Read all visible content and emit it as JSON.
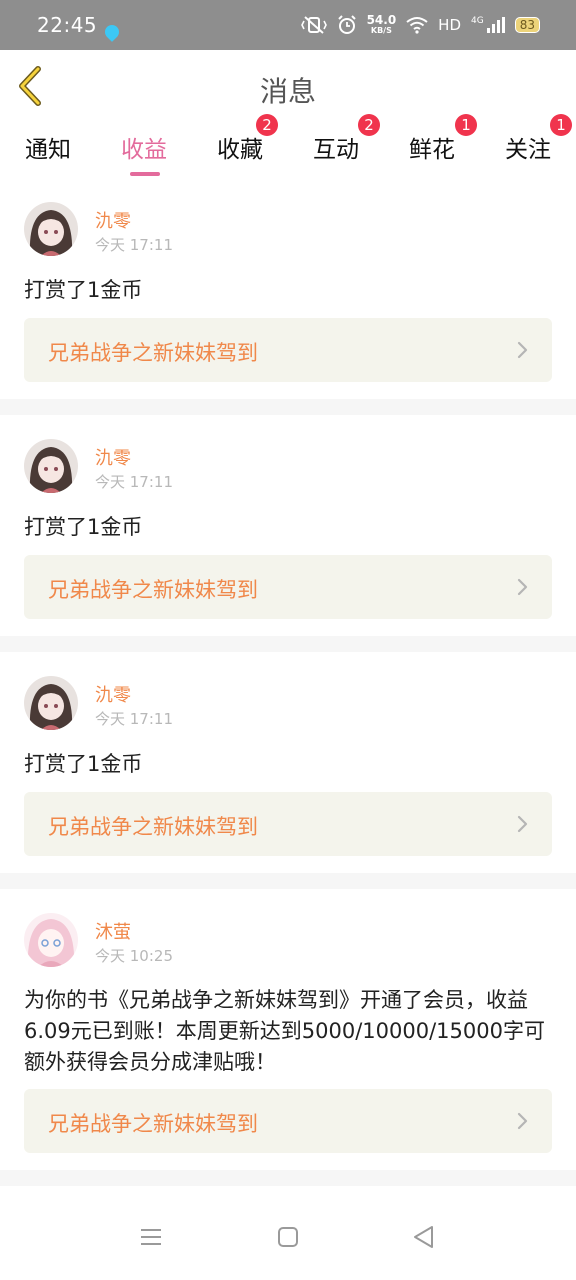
{
  "status_bar": {
    "time": "22:45",
    "net_speed_value": "54.0",
    "net_speed_unit": "KB/S",
    "hd": "HD",
    "network": "4G",
    "battery": "83"
  },
  "header": {
    "title": "消息",
    "back_icon": "chevron-left-icon"
  },
  "tabs": [
    {
      "label": "通知",
      "badge": "",
      "active": false
    },
    {
      "label": "收益",
      "badge": "",
      "active": true
    },
    {
      "label": "收藏",
      "badge": "2",
      "active": false
    },
    {
      "label": "互动",
      "badge": "2",
      "active": false
    },
    {
      "label": "鲜花",
      "badge": "1",
      "active": false
    },
    {
      "label": "关注",
      "badge": "1",
      "active": false
    }
  ],
  "messages": [
    {
      "user": "氿零",
      "time": "今天 17:11",
      "text": "打赏了1金币",
      "book": "兄弟战争之新妹妹驾到",
      "avatar": "avatar-dark-hair"
    },
    {
      "user": "氿零",
      "time": "今天 17:11",
      "text": "打赏了1金币",
      "book": "兄弟战争之新妹妹驾到",
      "avatar": "avatar-dark-hair"
    },
    {
      "user": "氿零",
      "time": "今天 17:11",
      "text": "打赏了1金币",
      "book": "兄弟战争之新妹妹驾到",
      "avatar": "avatar-dark-hair"
    },
    {
      "user": "沐萤",
      "time": "今天 10:25",
      "text": "为你的书《兄弟战争之新妹妹驾到》开通了会员，收益6.09元已到账！本周更新达到5000/10000/15000字可额外获得会员分成津贴哦！",
      "book": "兄弟战争之新妹妹驾到",
      "avatar": "avatar-pink-hair"
    }
  ],
  "colors": {
    "accent": "#e36b9c",
    "username": "#f0884a",
    "badge": "#f0344d",
    "book_bg": "#f4f4ec"
  },
  "nav": {
    "menu_icon": "menu-icon",
    "home_icon": "home-square-icon",
    "back_icon": "back-triangle-icon"
  }
}
